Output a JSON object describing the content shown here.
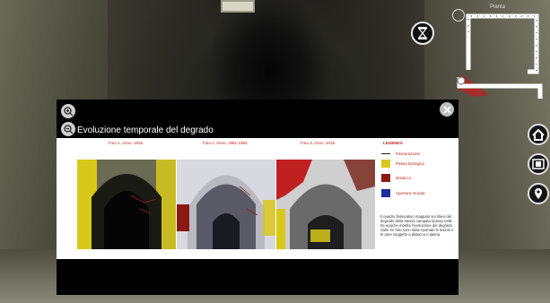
{
  "minimap": {
    "title": "Pianta"
  },
  "panel": {
    "title": "Evoluzione temporale del degrado",
    "photos": [
      {
        "caption": "Foto 1, Anno: 1915"
      },
      {
        "caption": "Foto 2, Anno: 1981-1983"
      },
      {
        "caption": "Foto 3, Anno: 2018"
      }
    ],
    "legend": {
      "title": "LEGENDA",
      "items": [
        {
          "label": "Fessurazione",
          "color": "#222222"
        },
        {
          "label": "Patina biologica",
          "color": "#d8c81a"
        },
        {
          "label": "Distacco",
          "color": "#8a1a12"
        },
        {
          "label": "Apertura murata",
          "color": "#1a2ea0"
        }
      ],
      "note": "Il quadro fessurativo mappato sui rilievi del degrado della stessa campata ripresa nelle tre epoche mostra l'evoluzione del degrado. Sulle tre foto sono state riportate le lesioni e le aree soggette a distacco e patina."
    }
  },
  "icons": {
    "zoom_in": "zoom-in-icon",
    "zoom_out": "zoom-out-icon",
    "close": "close-icon",
    "hourglass": "hourglass-icon",
    "home": "home-icon",
    "gallery": "film-icon",
    "location": "location-pin-icon"
  }
}
